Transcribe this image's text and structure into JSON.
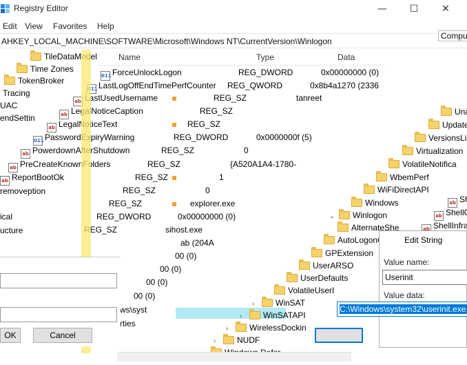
{
  "window1": {
    "title": "Registry Editor",
    "controls": {
      "minimize": "—",
      "maximize": "☐",
      "close": "✕"
    },
    "menu": [
      "Edit",
      "View",
      "Favorites",
      "Help"
    ],
    "address": "AHKEY_LOCAL_MACHINE\\SOFTWARE\\Microsoft\\Windows NT\\CurrentVersion\\Winlogon"
  },
  "window2": {
    "computer_label": "Compu"
  },
  "tree_left": [
    "TileDataModel",
    "Time Zones",
    "TokenBroker",
    "Tracing",
    "UAC",
    "endSettin",
    "removeption",
    "ical",
    "ucture"
  ],
  "tree_right": [
    "Unat",
    "Update",
    "VersionsLi",
    "Virtualization",
    "VolatileNotifica",
    "WbemPerf",
    "WiFiDirectAPI",
    "Windows",
    "Winlogon",
    "AlternateShe",
    "AutoLogonC",
    "GPExtension",
    "UserARSO",
    "UserDefaults",
    "VolatileUserI",
    "WinSAT",
    "WinSATAPI",
    "WirelessDockin",
    "NUDF",
    "Windows Defer"
  ],
  "tree_far_right": [
    "Sh",
    "ShellCo",
    "ShellInfras"
  ],
  "list": {
    "headers": {
      "name": "Name",
      "type": "Type",
      "data": "Data"
    },
    "rows": [
      {
        "name": "ForceUnlockLogon",
        "type": "REG_DWORD",
        "data": "0x00000000 (0)"
      },
      {
        "name": "LastLogOffEndTimePerfCounter",
        "type": "REG_QWORD",
        "data": "0x8b4a1270 (2336"
      },
      {
        "name": "LastUsedUsername",
        "type": "REG_SZ",
        "data": "tanreet"
      },
      {
        "name": "LegalNoticeCaption",
        "type": "REG_SZ",
        "data": ""
      },
      {
        "name": "LegalNoticeText",
        "type": "REG_SZ",
        "data": ""
      },
      {
        "name": "PasswordExpiryWarning",
        "type": "REG_DWORD",
        "data": "0x0000000f (5)"
      },
      {
        "name": "PowerdownAfterShutdown",
        "type": "REG_SZ",
        "data": "0"
      },
      {
        "name": "PreCreateKnownFolders",
        "type": "REG_SZ",
        "data": "{A520A1A4-1780-"
      },
      {
        "name": "ReportBootOk",
        "type": "REG_SZ",
        "data": "1"
      },
      {
        "name": "",
        "type": "REG_SZ",
        "data": "0"
      },
      {
        "name": "",
        "type": "REG_SZ",
        "data": "explorer.exe"
      },
      {
        "name": "",
        "type": "REG_DWORD",
        "data": "0x00000000 (0)"
      },
      {
        "name": "",
        "type": "REG_SZ",
        "data": "sihost.exe"
      }
    ],
    "extra_data": [
      "ab (204A",
      "00 (0)",
      "00 (0)",
      "00 (0)",
      "00 (0)",
      "ws\\syst",
      "operties"
    ]
  },
  "dialog": {
    "title": "Edit String",
    "value_name_label": "Value name:",
    "value_name": "Userinit",
    "value_data_label": "Value data:",
    "value_data": "C:\\Windows\\system32\\userinit.exe,"
  },
  "buttons": {
    "ok": "OK",
    "cancel": "Cancel"
  }
}
